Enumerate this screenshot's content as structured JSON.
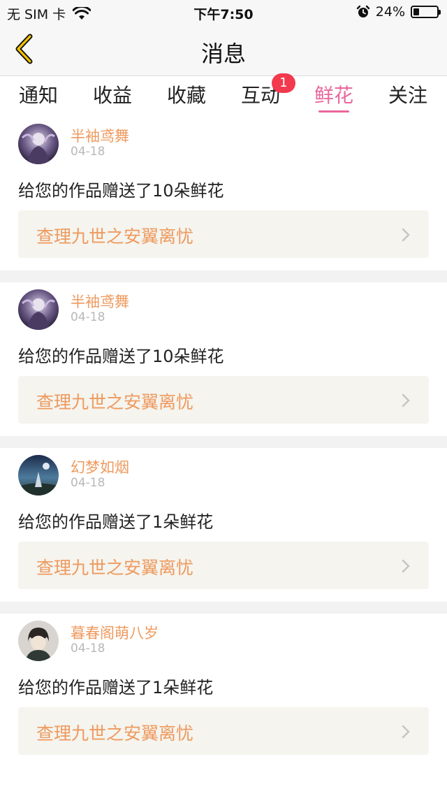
{
  "status_bar": {
    "carrier": "无 SIM 卡",
    "time": "下午7:50",
    "battery_percent": "24%",
    "battery_level": 0.24,
    "icons": [
      "wifi-icon",
      "alarm-icon",
      "battery-icon"
    ]
  },
  "nav": {
    "title": "消息",
    "back_icon": "chevron-left-icon"
  },
  "tabs": [
    {
      "label": "通知",
      "active": false
    },
    {
      "label": "收益",
      "active": false
    },
    {
      "label": "收藏",
      "active": false
    },
    {
      "label": "互动",
      "active": false,
      "badge": "1"
    },
    {
      "label": "鲜花",
      "active": true
    },
    {
      "label": "关注",
      "active": false
    }
  ],
  "colors": {
    "accent": "#e9679d",
    "username": "#ee9a5f",
    "badge": "#f2394d",
    "work_box_bg": "#f5f4ee"
  },
  "messages": [
    {
      "username": "半袖鸢舞",
      "date": "04-18",
      "text": "给您的作品赠送了10朵鲜花",
      "work_title": "查理九世之安翼离忧",
      "avatar": "avatar-1"
    },
    {
      "username": "半袖鸢舞",
      "date": "04-18",
      "text": "给您的作品赠送了10朵鲜花",
      "work_title": "查理九世之安翼离忧",
      "avatar": "avatar-1"
    },
    {
      "username": "幻梦如烟",
      "date": "04-18",
      "text": "给您的作品赠送了1朵鲜花",
      "work_title": "查理九世之安翼离忧",
      "avatar": "avatar-2"
    },
    {
      "username": "暮春阁萌八岁",
      "date": "04-18",
      "text": "给您的作品赠送了1朵鲜花",
      "work_title": "查理九世之安翼离忧",
      "avatar": "avatar-3"
    }
  ]
}
